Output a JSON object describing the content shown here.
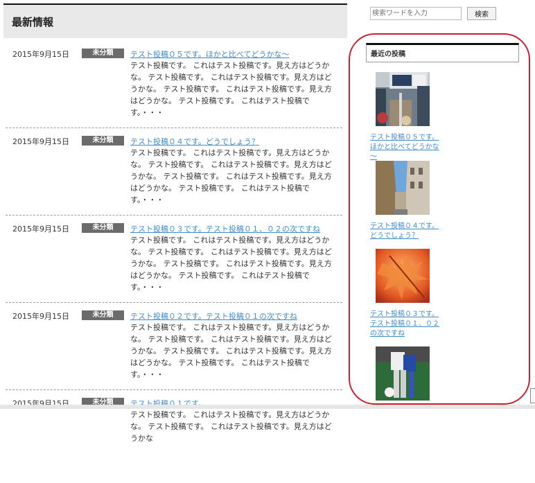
{
  "main": {
    "heading": "最新情報",
    "posts": [
      {
        "date": "2015年9月15日",
        "category": "未分類",
        "title": "テスト投稿０５です。ほかと比べてどうかな～",
        "body": "テスト投稿です。 これはテスト投稿です。見え方はどうかな。 テスト投稿です。 これはテスト投稿です。見え方はどうかな。 テスト投稿です。 これはテスト投稿です。見え方はどうかな。 テスト投稿です。 これはテスト投稿です。・・・"
      },
      {
        "date": "2015年9月15日",
        "category": "未分類",
        "title": "テスト投稿０４です。どうでしょう？",
        "body": "テスト投稿です。 これはテスト投稿です。見え方はどうかな。 テスト投稿です。 これはテスト投稿です。見え方はどうかな。 テスト投稿です。 これはテスト投稿です。見え方はどうかな。 テスト投稿です。 これはテスト投稿です。・・・"
      },
      {
        "date": "2015年9月15日",
        "category": "未分類",
        "title": "テスト投稿０３です。テスト投稿０１、０２の次ですね",
        "body": "テスト投稿です。 これはテスト投稿です。見え方はどうかな。 テスト投稿です。 これはテスト投稿です。見え方はどうかな。 テスト投稿です。 これはテスト投稿です。見え方はどうかな。 テスト投稿です。 これはテスト投稿です。・・・"
      },
      {
        "date": "2015年9月15日",
        "category": "未分類",
        "title": "テスト投稿０２です。テスト投稿０１の次ですね",
        "body": "テスト投稿です。 これはテスト投稿です。見え方はどうかな。 テスト投稿です。 これはテスト投稿です。見え方はどうかな。 テスト投稿です。 これはテスト投稿です。見え方はどうかな。 テスト投稿です。 これはテスト投稿です。・・・"
      },
      {
        "date": "2015年9月15日",
        "category": "未分類",
        "title": "テスト投稿０１です。",
        "body": "テスト投稿です。 これはテスト投稿です。見え方はどうかな。 テスト投稿です。 これはテスト投稿です。見え方はどうかな"
      }
    ]
  },
  "sidebar": {
    "search": {
      "placeholder": "検索ワードを入力",
      "button": "検索"
    },
    "recent_heading": "最近の投稿",
    "recent_posts": [
      {
        "title": "テスト投稿０５です。ほかと比べてどうかな～",
        "image": "street-sign-photo"
      },
      {
        "title": "テスト投稿０４です。どうでしょう？",
        "image": "city-street-photo"
      },
      {
        "title": "テスト投稿０３です。テスト投稿０１、０２の次ですね",
        "image": "autumn-leaves-photo"
      },
      {
        "title": "",
        "image": "soccer-player-photo"
      }
    ]
  },
  "colors": {
    "link": "#3f8bd0",
    "badge": "#6b6b6b",
    "highlight_circle": "#cc1f2d"
  }
}
